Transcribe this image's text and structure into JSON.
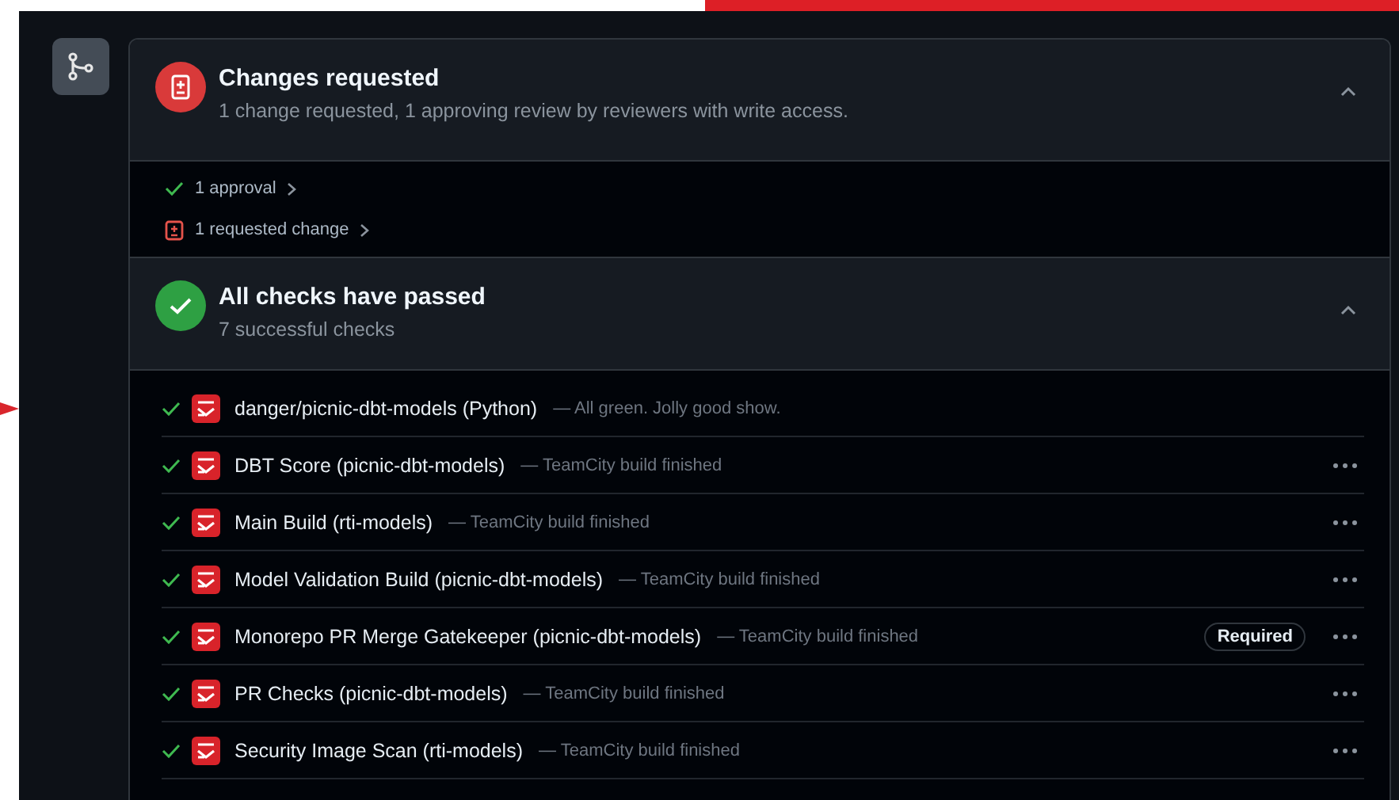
{
  "review": {
    "title": "Changes requested",
    "subtitle": "1 change requested, 1 approving review by reviewers with write access.",
    "expanded": true,
    "items": [
      {
        "kind": "approval",
        "label": "1 approval"
      },
      {
        "kind": "change",
        "label": "1 requested change"
      }
    ]
  },
  "checks_summary": {
    "title": "All checks have passed",
    "subtitle": "7 successful checks",
    "expanded": true
  },
  "checks": [
    {
      "name": "danger/picnic-dbt-models (Python)",
      "description": "— All green. Jolly good show.",
      "has_menu": false
    },
    {
      "name": "DBT Score (picnic-dbt-models)",
      "description": "— TeamCity build finished",
      "has_menu": true
    },
    {
      "name": "Main Build (rti-models)",
      "description": "— TeamCity build finished",
      "has_menu": true
    },
    {
      "name": "Model Validation Build (picnic-dbt-models)",
      "description": "— TeamCity build finished",
      "has_menu": true
    },
    {
      "name": "Monorepo PR Merge Gatekeeper (picnic-dbt-models)",
      "description": "— TeamCity build finished",
      "badge": "Required",
      "has_menu": true
    },
    {
      "name": "PR Checks (picnic-dbt-models)",
      "description": "— TeamCity build finished",
      "has_menu": true
    },
    {
      "name": "Security Image Scan (rti-models)",
      "description": "— TeamCity build finished",
      "has_menu": true
    }
  ]
}
